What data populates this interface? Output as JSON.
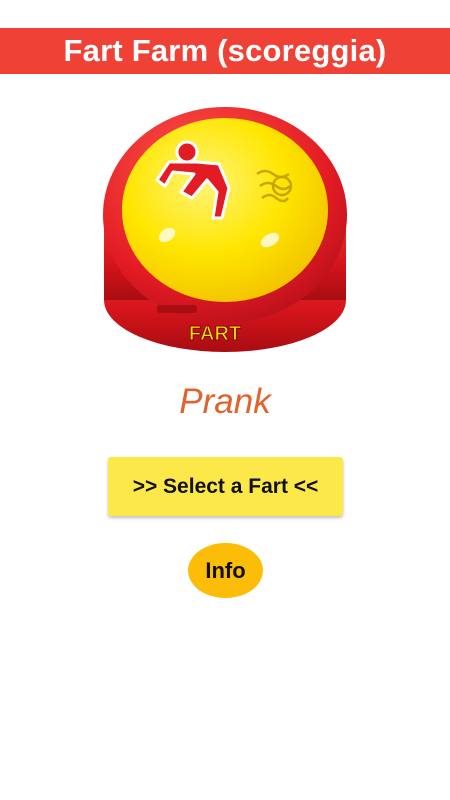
{
  "header": {
    "title": "Fart Farm (scoreggia)"
  },
  "buzzer": {
    "logo_text": "FART",
    "icon": "fart-buzzer-icon"
  },
  "main": {
    "prank_label": "Prank",
    "select_button_label": ">> Select a Fart <<",
    "info_button_label": "Info"
  },
  "colors": {
    "title_bar": "#ef4135",
    "prank_text": "#e3622a",
    "select_button": "#fde84a",
    "info_button": "#fbbd08",
    "buzzer_red": "#e31b23",
    "buzzer_yellow": "#ffe600"
  }
}
